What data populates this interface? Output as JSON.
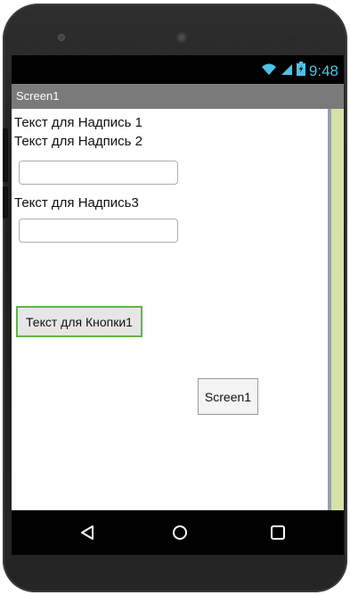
{
  "status_bar": {
    "time": "9:48",
    "icons": [
      "wifi-icon",
      "signal-icon",
      "battery-charging-icon"
    ]
  },
  "title_bar": {
    "title": "Screen1"
  },
  "components": {
    "label1": "Текст для Надпись 1",
    "label2": "Текст для Надпись 2",
    "textbox1": {
      "value": "",
      "placeholder": ""
    },
    "label3": "Текст для Надпись3",
    "textbox2": {
      "value": "",
      "placeholder": ""
    },
    "button1": "Текст для Кнопки1",
    "screen_tag": "Screen1"
  },
  "nav_bar": {
    "icons": [
      "back-icon",
      "home-icon",
      "recents-icon"
    ]
  },
  "colors": {
    "status_accent": "#4cc3e6",
    "title_bar": "#7a7a7a",
    "scroll_track": "#d5e3a7",
    "button_border": "#5fb44a"
  }
}
